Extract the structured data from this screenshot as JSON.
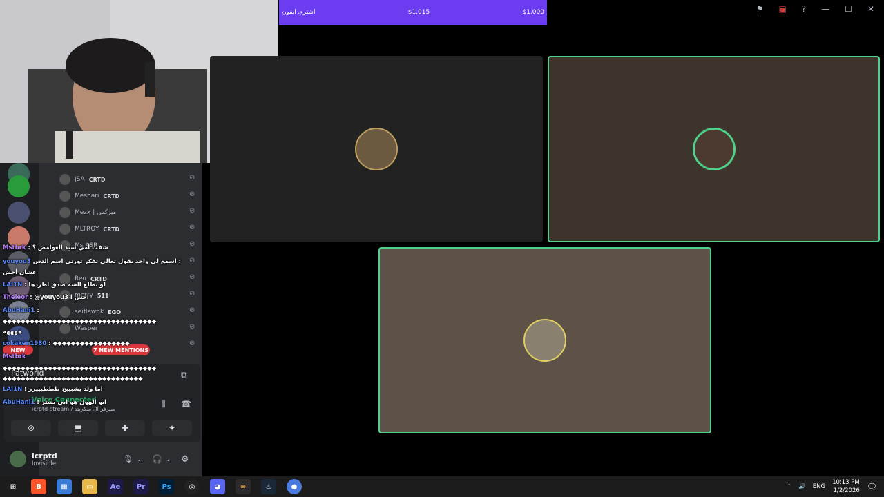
{
  "donation": {
    "label": "اشتري ايفون",
    "current": "$1,015",
    "goal": "$1,000"
  },
  "window_icons": [
    "flag-icon",
    "screen-icon",
    "help-icon",
    "minimize-icon",
    "maximize-icon",
    "close-icon"
  ],
  "members": [
    {
      "name": "JSA",
      "tag": "CRTD"
    },
    {
      "name": "Meshari",
      "tag": "CRTD"
    },
    {
      "name": "Mezx | ميزكس",
      "tag": ""
    },
    {
      "name": "MLTROY",
      "tag": "CRTD"
    },
    {
      "name": "Ms ASR",
      "tag": ""
    },
    {
      "name": "Reu",
      "tag": "CRTD"
    },
    {
      "name": "metry",
      "tag": "511"
    },
    {
      "name": "seiflawfik",
      "tag": "EGO"
    },
    {
      "name": "Wesper",
      "tag": ""
    }
  ],
  "mentions": "7 NEW MENTIONS",
  "new_label": "NEW",
  "chat": [
    {
      "user": "Mstbrk",
      "text": ": شفت أمي سيد الغوامض ؟"
    },
    {
      "user": "youyou3",
      "text": "اسمع لي واحد يقول تعالي تفكر تورني اسم الدس :"
    },
    {
      "user": "",
      "text": "عشان أخش"
    },
    {
      "user": "LAI1N",
      "text": ": لو تطلع السه صدق اطردها"
    },
    {
      "user": "Theleor",
      "text": ": @youyou3 احس ا"
    },
    {
      "user": "AbuHani1",
      "text": ":"
    },
    {
      "user": "",
      "text": "◆◆◆◆◆◆◆◆◆◆◆◆◆◆◆◆◆◆◆◆◆◆◆◆◆◆◆◆◆◆◆◆◆◆"
    },
    {
      "user": "",
      "text": "ههههه"
    },
    {
      "user": "cokaken1980",
      "text": ": ◆◆◆◆◆◆◆◆◆◆◆◆◆◆◆◆◆"
    },
    {
      "user": "Mstbrk",
      "text": ""
    },
    {
      "user": "",
      "text": "◆◆◆◆◆◆◆◆◆◆◆◆◆◆◆◆◆◆◆◆◆◆◆◆◆◆◆◆◆◆◆◆◆◆"
    },
    {
      "user": "",
      "text": "◆◆◆◆◆◆◆◆◆◆◆◆◆◆◆◆◆◆◆◆◆◆◆◆◆◆◆◆◆◆◆"
    },
    {
      "user": "LAI1N",
      "text": ": اما ولد يشبيبخ ططظيييرر"
    },
    {
      "user": "AbuHani1",
      "text": ": ابو الهول هو ابي بشتر"
    }
  ],
  "voice": {
    "user": "Patworld",
    "status": "Voice Connected",
    "channel": "icrptd-stream / سيرفر آل سكربتد"
  },
  "user": {
    "name": "icrptd",
    "status": "Invisible"
  },
  "clock": {
    "time": "10:13 PM",
    "date": "1/2/2026"
  },
  "lang": "ENG",
  "taskbar_apps": [
    "windows-icon",
    "brave-icon",
    "store-icon",
    "explorer-icon",
    "aftereffects-icon",
    "premiere-icon",
    "photoshop-icon",
    "obs-icon",
    "discord-icon",
    "app-icon",
    "steam-icon",
    "chrome-icon"
  ]
}
